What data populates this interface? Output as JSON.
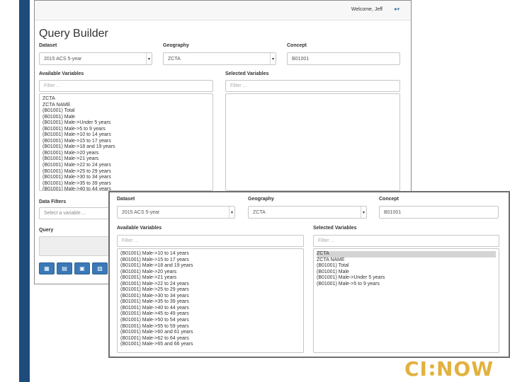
{
  "header": {
    "welcome": "Welcome, Jeff"
  },
  "page": {
    "title": "Query Builder"
  },
  "back_panel": {
    "dataset": {
      "label": "Dataset",
      "value": "2015 ACS 5-year"
    },
    "geography": {
      "label": "Geography",
      "value": "ZCTA"
    },
    "concept": {
      "label": "Concept",
      "value": "B01001"
    },
    "available": {
      "label": "Available Variables",
      "filter_placeholder": "Filter ...",
      "items": [
        "ZCTA",
        "ZCTA NAME",
        "(B01001) Total",
        "(B01001) Male",
        "(B01001) Male->Under 5 years",
        "(B01001) Male->5 to 9 years",
        "(B01001) Male->10 to 14 years",
        "(B01001) Male->15 to 17 years",
        "(B01001) Male->18 and 19 years",
        "(B01001) Male->20 years",
        "(B01001) Male->21 years",
        "(B01001) Male->22 to 24 years",
        "(B01001) Male->25 to 29 years",
        "(B01001) Male->30 to 34 years",
        "(B01001) Male->35 to 39 years",
        "(B01001) Male->40 to 44 years"
      ]
    },
    "selected": {
      "label": "Selected Variables",
      "filter_placeholder": "Filter ..."
    },
    "data_filters": {
      "label": "Data Filters",
      "select_placeholder": "Select a variable ..."
    },
    "query": {
      "label": "Query"
    }
  },
  "front_panel": {
    "dataset": {
      "label": "Dataset",
      "value": "2015 ACS 5-year"
    },
    "geography": {
      "label": "Geography",
      "value": "ZCTA"
    },
    "concept": {
      "label": "Concept",
      "value": "B01001"
    },
    "available": {
      "label": "Available Variables",
      "filter_placeholder": "Filter ...",
      "items": [
        "(B01001) Male->10 to 14 years",
        "(B01001) Male->15 to 17 years",
        "(B01001) Male->18 and 19 years",
        "(B01001) Male->20 years",
        "(B01001) Male->21 years",
        "(B01001) Male->22 to 24 years",
        "(B01001) Male->25 to 29 years",
        "(B01001) Male->30 to 34 years",
        "(B01001) Male->35 to 39 years",
        "(B01001) Male->40 to 44 years",
        "(B01001) Male->45 to 49 years",
        "(B01001) Male->50 to 54 years",
        "(B01001) Male->55 to 59 years",
        "(B01001) Male->60 and 61 years",
        "(B01001) Male->62 to 64 years",
        "(B01001) Male->65 and 66 years"
      ]
    },
    "selected": {
      "label": "Selected Variables",
      "filter_placeholder": "Filter ...",
      "items": [
        "ZCTA",
        "ZCTA NAME",
        "(B01001) Total",
        "(B01001) Male",
        "(B01001) Male->Under 5 years",
        "(B01001) Male->5 to 9 years"
      ]
    }
  },
  "toolbar": {
    "buttons": [
      {
        "icon": "table-icon",
        "glyph": "▦"
      },
      {
        "icon": "spreadsheet-icon",
        "glyph": "▤"
      },
      {
        "icon": "document-icon",
        "glyph": "▣"
      },
      {
        "icon": "export-icon",
        "glyph": "▧"
      }
    ]
  },
  "logo": {
    "text_left": "CI",
    "text_right": "NOW"
  },
  "colors": {
    "accent_bar": "#1d4b7c",
    "button_blue": "#3b78b7",
    "logo_gold": "#e2b13e"
  }
}
